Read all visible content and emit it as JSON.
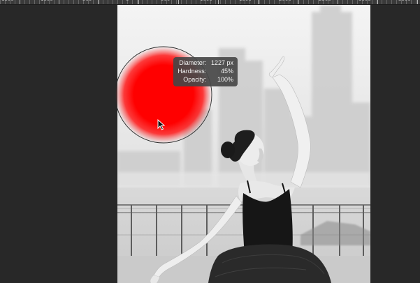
{
  "ruler": {
    "labels": [
      "1500",
      "1000",
      "500",
      "0",
      "500",
      "1000",
      "1500",
      "2000",
      "2500",
      "3000",
      "3500"
    ]
  },
  "brush_tooltip": {
    "diameter_label": "Diameter:",
    "diameter_value": "1227 px",
    "hardness_label": "Hardness:",
    "hardness_value": "45%",
    "opacity_label": "Opacity:",
    "opacity_value": "100%"
  },
  "brush": {
    "color": "#ff0000",
    "tool_icon": "brush-circle-icon"
  },
  "cursor": {
    "icon": "pointer-arrow-icon"
  }
}
